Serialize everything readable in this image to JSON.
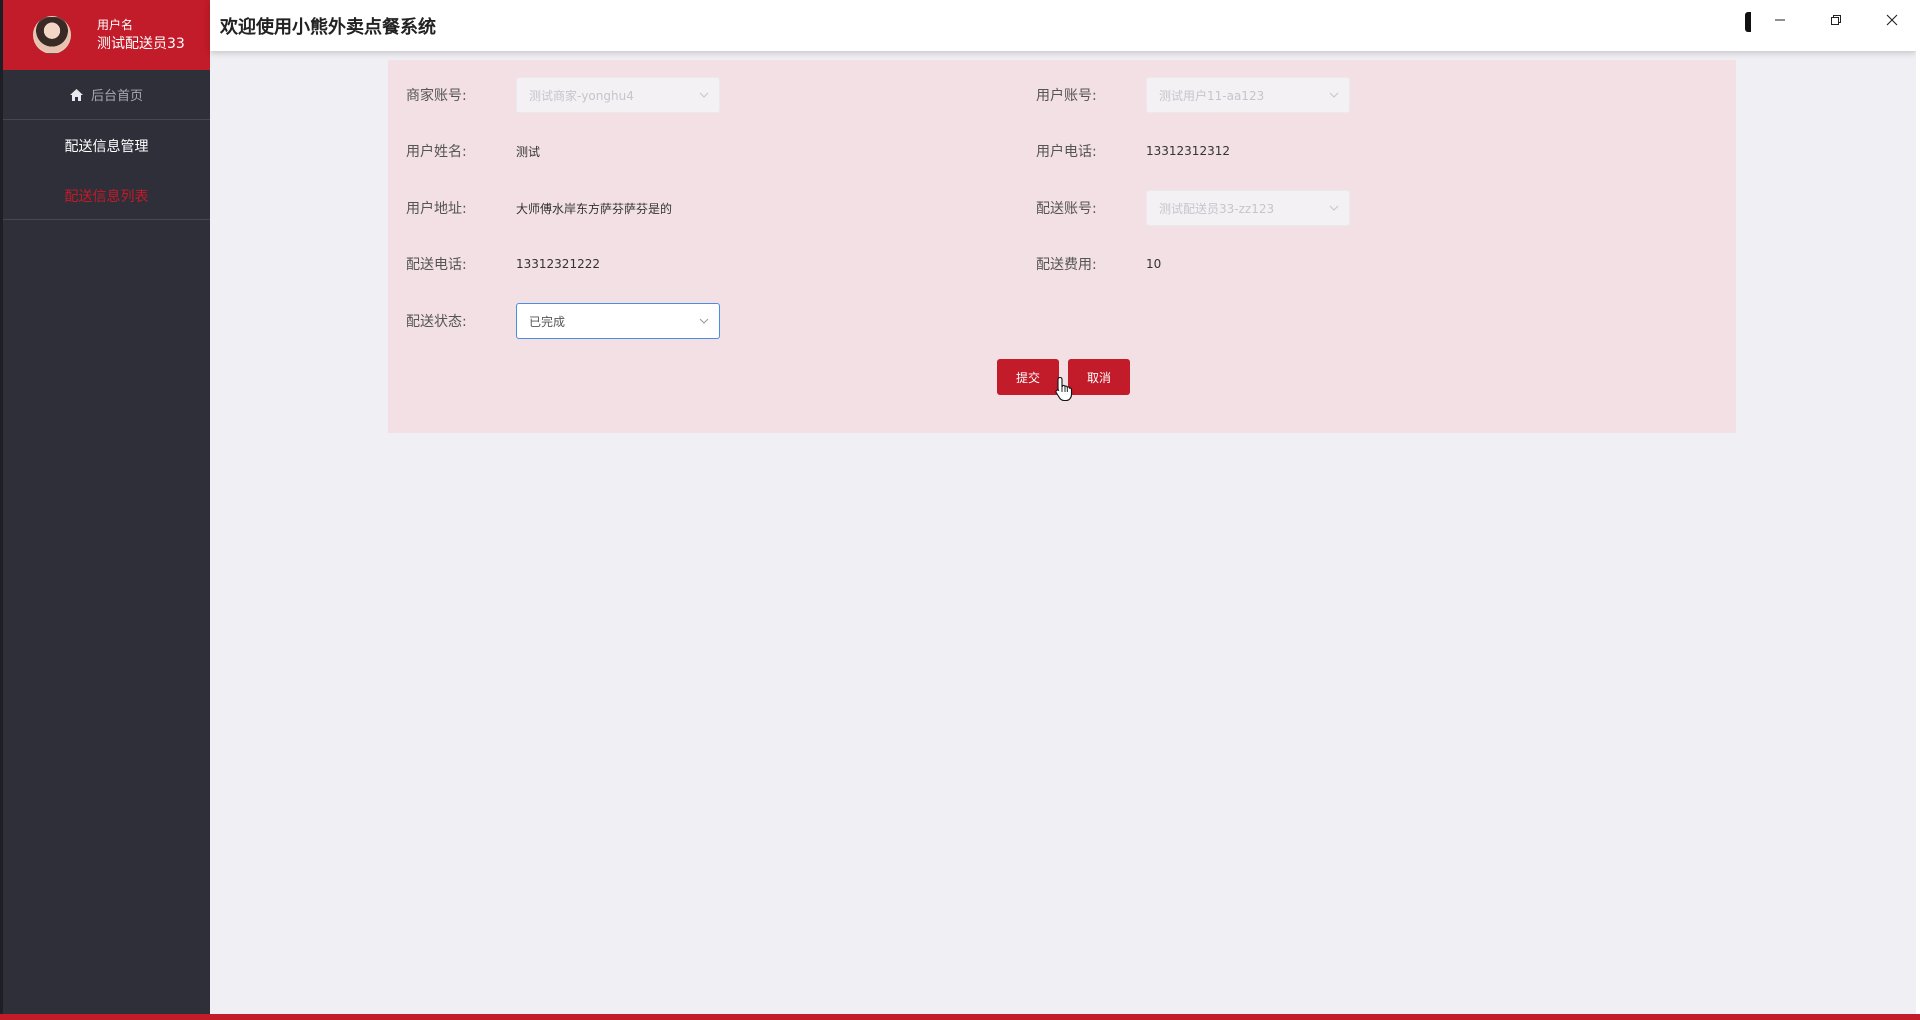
{
  "window": {
    "title": "欢迎使用小熊外卖点餐系统"
  },
  "user": {
    "label": "用户名",
    "name": "测试配送员33"
  },
  "sidebar": {
    "home_label": "后台首页",
    "group_label": "配送信息管理",
    "sub_label": "配送信息列表"
  },
  "form": {
    "merchant_account": {
      "label": "商家账号:",
      "value": "测试商家-yonghu4"
    },
    "user_account": {
      "label": "用户账号:",
      "value": "测试用户11-aa123"
    },
    "user_name": {
      "label": "用户姓名:",
      "value": "测试"
    },
    "user_phone": {
      "label": "用户电话:",
      "value": "13312312312"
    },
    "user_address": {
      "label": "用户地址:",
      "value": "大师傅水岸东方萨芬萨芬是的"
    },
    "delivery_account": {
      "label": "配送账号:",
      "value": "测试配送员33-zz123"
    },
    "delivery_phone": {
      "label": "配送电话:",
      "value": "13312321222"
    },
    "delivery_fee": {
      "label": "配送费用:",
      "value": "10"
    },
    "delivery_status": {
      "label": "配送状态:",
      "value": "已完成"
    },
    "submit_label": "提交",
    "cancel_label": "取消"
  },
  "colors": {
    "brand": "#c21b2a",
    "sidebar_bg": "#2e2f38",
    "card_bg": "#f3e0e4"
  }
}
